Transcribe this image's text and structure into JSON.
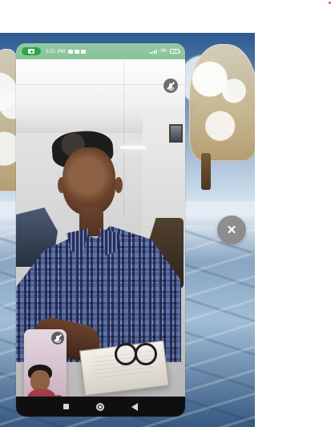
{
  "status_bar": {
    "time": "5:51 PM",
    "battery_level": "25",
    "icons": {
      "camera": "camera-icon",
      "signal": "signal-icon",
      "wifi": "wifi-icon",
      "battery": "battery-icon"
    },
    "colors": {
      "status_bar_bg": "#8fc69d",
      "camera_pill": "#28a745"
    }
  },
  "call": {
    "remote_mute_icon": "mute-mic-icon",
    "self_mute_icon": "mute-mic-icon",
    "self_view_switch_icon": "switch-camera-icon"
  },
  "controls": {
    "close_icon": "close-icon",
    "close_label": "×",
    "close_button_color": "#878787"
  },
  "navigation": {
    "recents_icon": "square-icon",
    "home_icon": "circle-icon",
    "back_icon": "triangle-back-icon",
    "nav_bar_color": "#0f0f0f"
  }
}
